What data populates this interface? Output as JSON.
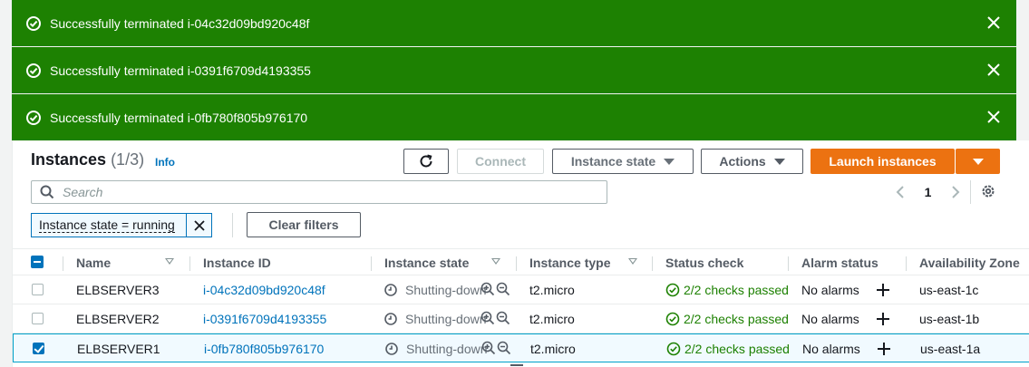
{
  "flashes": [
    {
      "message": "Successfully terminated i-04c32d09bd920c48f"
    },
    {
      "message": "Successfully terminated i-0391f6709d4193355"
    },
    {
      "message": "Successfully terminated i-0fb780f805b976170"
    }
  ],
  "header": {
    "title": "Instances",
    "count": "(1/3)",
    "info": "Info",
    "connect_label": "Connect",
    "instance_state_label": "Instance state",
    "actions_label": "Actions",
    "launch_label": "Launch instances"
  },
  "search": {
    "placeholder": "Search"
  },
  "pagination": {
    "page": "1"
  },
  "filter": {
    "token": "Instance state = running",
    "clear_label": "Clear filters"
  },
  "table": {
    "columns": [
      "Name",
      "Instance ID",
      "Instance state",
      "Instance type",
      "Status check",
      "Alarm status",
      "Availability Zone"
    ],
    "rows": [
      {
        "name": "ELBSERVER3",
        "id": "i-04c32d09bd920c48f",
        "state": "Shutting-down",
        "type": "t2.micro",
        "check": "2/2 checks passed",
        "alarm": "No alarms",
        "az": "us-east-1c",
        "selected": false
      },
      {
        "name": "ELBSERVER2",
        "id": "i-0391f6709d4193355",
        "state": "Shutting-down",
        "type": "t2.micro",
        "check": "2/2 checks passed",
        "alarm": "No alarms",
        "az": "us-east-1b",
        "selected": false
      },
      {
        "name": "ELBSERVER1",
        "id": "i-0fb780f805b976170",
        "state": "Shutting-down",
        "type": "t2.micro",
        "check": "2/2 checks passed",
        "alarm": "No alarms",
        "az": "us-east-1a",
        "selected": true
      }
    ]
  },
  "colors": {
    "success": "#1d8102",
    "primary": "#ec7211",
    "link": "#0073bb"
  }
}
